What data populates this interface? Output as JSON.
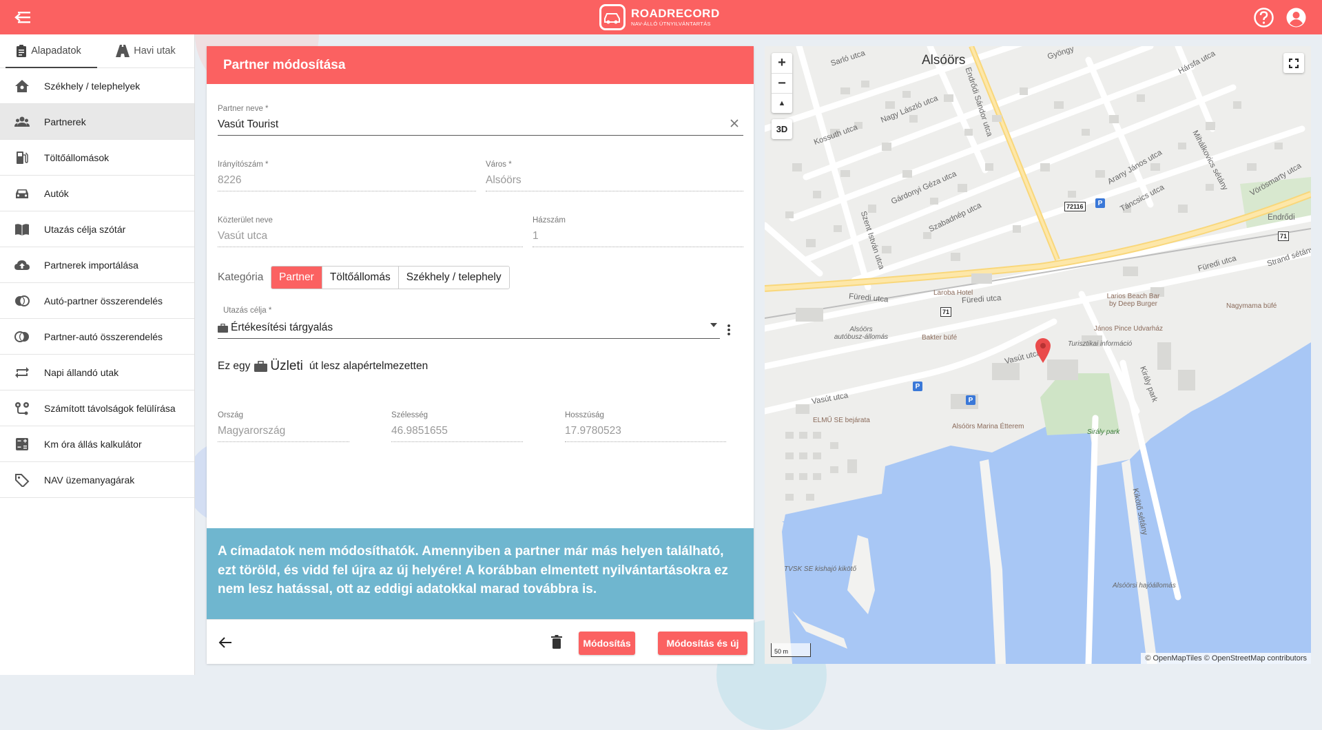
{
  "header": {
    "logo_name": "ROADRECORD",
    "logo_sub": "NAV-ÁLLÓ ÚTNYILVÁNTARTÁS",
    "menu_icon": "menu-collapse-icon",
    "help_icon": "help-icon",
    "account_icon": "account-icon",
    "accent_color": "#fb6161"
  },
  "sidebar": {
    "tabs": [
      {
        "label": "Alapadatok",
        "icon": "clipboard-icon",
        "active": true
      },
      {
        "label": "Havi utak",
        "icon": "road-icon",
        "active": false
      }
    ],
    "items": [
      {
        "label": "Székhely / telephelyek",
        "icon": "home-icon"
      },
      {
        "label": "Partnerek",
        "icon": "people-icon",
        "active": true
      },
      {
        "label": "Töltőállomások",
        "icon": "fuel-icon"
      },
      {
        "label": "Autók",
        "icon": "car-icon"
      },
      {
        "label": "Utazás célja szótár",
        "icon": "book-icon"
      },
      {
        "label": "Partnerek importálása",
        "icon": "cloud-upload-icon"
      },
      {
        "label": "Autó-partner összerendelés",
        "icon": "link-icon"
      },
      {
        "label": "Partner-autó összerendelés",
        "icon": "link-icon"
      },
      {
        "label": "Napi állandó utak",
        "icon": "repeat-icon"
      },
      {
        "label": "Számított távolságok felülírása",
        "icon": "route-icon"
      },
      {
        "label": "Km óra állás kalkulátor",
        "icon": "calculator-icon"
      },
      {
        "label": "NAV üzemanyagárak",
        "icon": "tag-icon"
      }
    ]
  },
  "form": {
    "title": "Partner módosítása",
    "partner_name": {
      "label": "Partner neve *",
      "value": "Vasút Tourist"
    },
    "zip": {
      "label": "Irányítószám *",
      "value": "8226"
    },
    "city": {
      "label": "Város *",
      "value": "Alsóörs"
    },
    "street": {
      "label": "Közterület neve",
      "value": "Vasút utca"
    },
    "house_no": {
      "label": "Házszám",
      "value": "1"
    },
    "category": {
      "label": "Kategória",
      "options": [
        "Partner",
        "Töltőállomás",
        "Székhely / telephely"
      ],
      "selected": "Partner"
    },
    "purpose": {
      "label": "Utazás célja *",
      "value": "Értékesítési tárgyalás"
    },
    "default_text": {
      "prefix": "Ez egy",
      "type": "Üzleti",
      "suffix": "út lesz alapértelmezetten"
    },
    "country": {
      "label": "Ország",
      "value": "Magyarország"
    },
    "lat": {
      "label": "Szélesség",
      "value": "46.9851655"
    },
    "lng": {
      "label": "Hosszúság",
      "value": "17.9780523"
    },
    "info": "A címadatok nem módosíthatók. Amennyiben a partner már más helyen található, ezt töröld, és vidd fel újra az új helyére! A korábban elmentett nyilvántartásokra ez nem lesz hatással, ott az eddigi adatokkal marad továbbra is.",
    "btn_modify": "Módosítás",
    "btn_modify_new": "Módosítás és új"
  },
  "map": {
    "zoom_in": "+",
    "zoom_out": "−",
    "compass": "▲",
    "btn_3d": "3D",
    "town": "Alsóörs",
    "streets": [
      "Sarló utca",
      "Gyöngy",
      "Hársfa utca",
      "Endrődi Sándor utca",
      "Nagy László utca",
      "Kossuth utca",
      "Gárdonyi Géza utca",
      "Szabadnép utca",
      "Arany János utca",
      "Táncsics utca",
      "Mihálkovics sétány",
      "Vörösmarty utca",
      "Szent István utca",
      "Füredi utca",
      "Füredi utca",
      "Füredi utca",
      "Strand sétány",
      "Vasút utca",
      "Vasút utca",
      "Király park",
      "Kikötő sétány",
      "Endrődi"
    ],
    "pois": [
      "Laroba Hotel",
      "Larios Beach Bar by Deep Burger",
      "Nagymama büfé",
      "Alsóörs autóbusz-állomás",
      "Bakter büfé",
      "Turisztikai információ",
      "János Pince Udvarház",
      "ELMŰ SE bejárata",
      "Alsóörs Marina Étterem",
      "Sirály park",
      "TVSK SE kishajó kikötő",
      "Alsóörsi hajóállomás"
    ],
    "road_signs": [
      "72116",
      "71",
      "71"
    ],
    "parking": "P",
    "scale": "50 m",
    "attribution": "© OpenMapTiles © OpenStreetMap contributors"
  }
}
